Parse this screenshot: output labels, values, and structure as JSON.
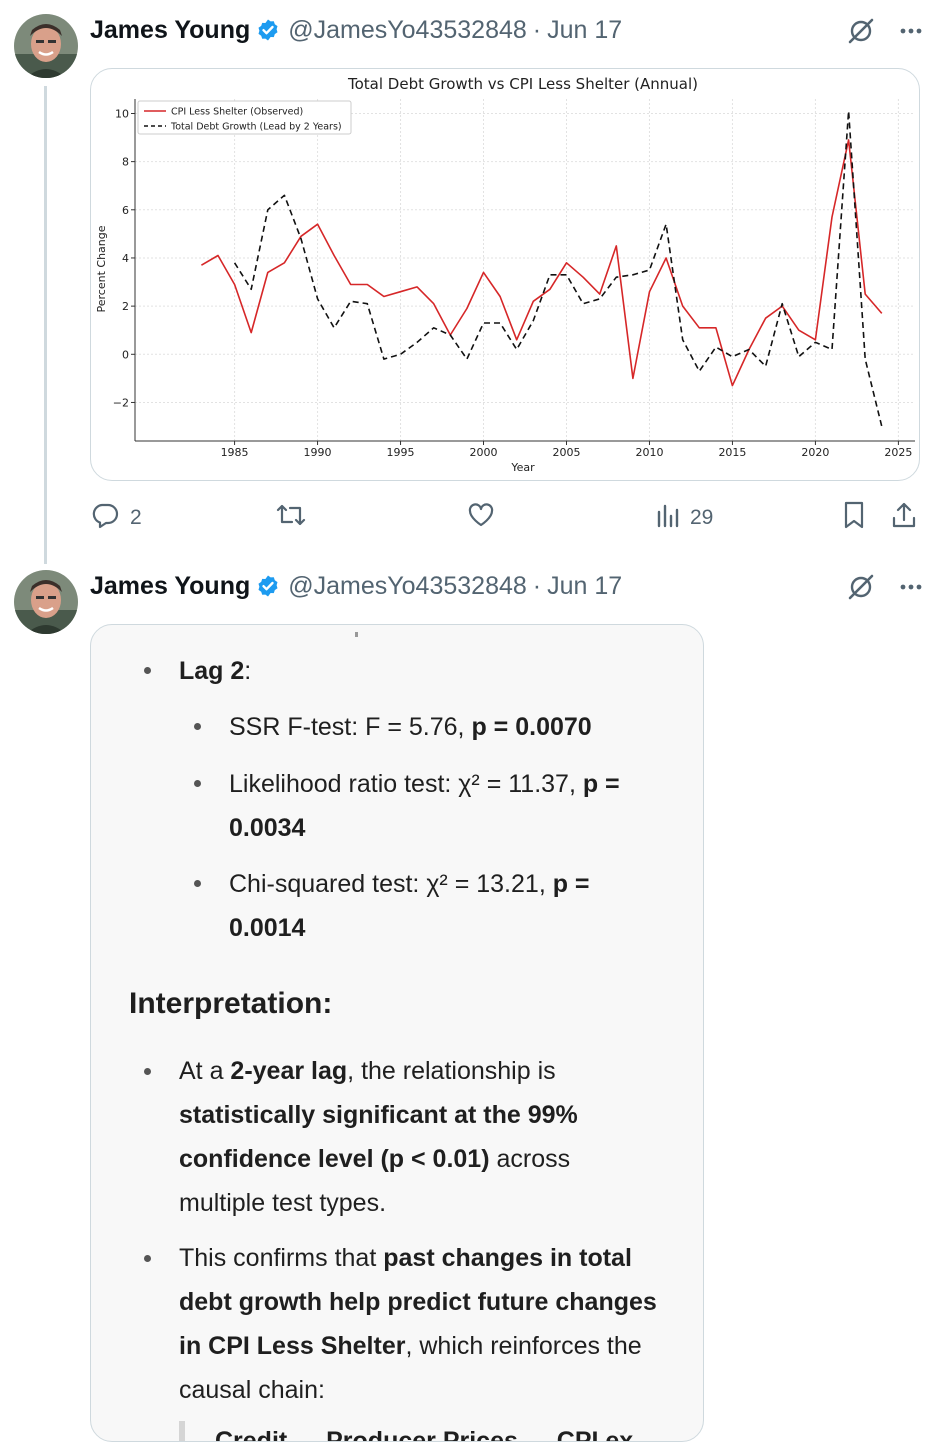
{
  "tweets": [
    {
      "author_name": "James Young",
      "handle": "@JamesYo43532848",
      "separator": "·",
      "date": "Jun 17",
      "actions": {
        "replies": "2",
        "retweets": "",
        "likes": "",
        "views": "29"
      }
    },
    {
      "author_name": "James Young",
      "handle": "@JamesYo43532848",
      "separator": "·",
      "date": "Jun 17"
    }
  ],
  "chart_data": {
    "type": "line",
    "title": "Total Debt Growth vs CPI Less Shelter (Annual)",
    "xlabel": "Year",
    "ylabel": "Percent Change",
    "xlim": [
      1979,
      2026
    ],
    "ylim": [
      -3.6,
      10.6
    ],
    "x_ticks": [
      "1985",
      "1990",
      "1995",
      "2000",
      "2005",
      "2010",
      "2015",
      "2020",
      "2025"
    ],
    "y_ticks": [
      "−2",
      "0",
      "2",
      "4",
      "6",
      "8",
      "10"
    ],
    "grid": true,
    "legend_position": "top-left",
    "series": [
      {
        "name": "CPI Less Shelter (Observed)",
        "color": "#d62728",
        "style": "solid",
        "x": [
          1983,
          1984,
          1985,
          1986,
          1987,
          1988,
          1989,
          1990,
          1991,
          1992,
          1993,
          1994,
          1995,
          1996,
          1997,
          1998,
          1999,
          2000,
          2001,
          2002,
          2003,
          2004,
          2005,
          2006,
          2007,
          2008,
          2009,
          2010,
          2011,
          2012,
          2013,
          2014,
          2015,
          2016,
          2017,
          2018,
          2019,
          2020,
          2021,
          2022,
          2023,
          2024
        ],
        "y": [
          3.7,
          4.1,
          2.9,
          0.9,
          3.4,
          3.8,
          4.9,
          5.4,
          4.1,
          2.9,
          2.9,
          2.4,
          2.6,
          2.8,
          2.1,
          0.8,
          1.9,
          3.4,
          2.4,
          0.6,
          2.2,
          2.7,
          3.8,
          3.2,
          2.5,
          4.5,
          -1.0,
          2.6,
          4.0,
          2.0,
          1.1,
          1.1,
          -1.3,
          0.2,
          1.5,
          2.0,
          1.0,
          0.6,
          5.7,
          8.9,
          2.5,
          1.7
        ]
      },
      {
        "name": "Total Debt Growth (Lead by 2 Years)",
        "color": "#111111",
        "style": "dashed",
        "x": [
          1985,
          1986,
          1987,
          1988,
          1989,
          1990,
          1991,
          1992,
          1993,
          1994,
          1995,
          1996,
          1997,
          1998,
          1999,
          2000,
          2001,
          2002,
          2003,
          2004,
          2005,
          2006,
          2007,
          2008,
          2009,
          2010,
          2011,
          2012,
          2013,
          2014,
          2015,
          2016,
          2017,
          2018,
          2019,
          2020,
          2021,
          2022,
          2023,
          2024
        ],
        "y": [
          3.8,
          2.7,
          6.0,
          6.6,
          4.8,
          2.3,
          1.1,
          2.2,
          2.1,
          -0.2,
          0.0,
          0.5,
          1.1,
          0.8,
          -0.2,
          1.3,
          1.3,
          0.2,
          1.4,
          3.3,
          3.3,
          2.1,
          2.3,
          3.2,
          3.3,
          3.5,
          5.4,
          0.6,
          -0.7,
          0.3,
          -0.1,
          0.2,
          -0.5,
          2.1,
          -0.1,
          0.5,
          0.2,
          10.1,
          -0.2,
          -3.0
        ]
      }
    ]
  },
  "screenshot": {
    "lag_label": "Lag 2",
    "lag_colon": ":",
    "sub_items": [
      {
        "text": "SSR F-test: F = 5.76, ",
        "bold": "p = 0.0070"
      },
      {
        "text": "Likelihood ratio test: χ² = 11.37, ",
        "bold": "p =",
        "bold2": "0.0034"
      },
      {
        "text": "Chi-squared test: χ² = 13.21, ",
        "bold": "p =",
        "bold2": "0.0014"
      }
    ],
    "heading": "Interpretation:",
    "interp1": {
      "pre": "At a ",
      "b1": "2-year lag",
      "mid": ", the relationship is",
      "b2": "statistically significant at the 99%",
      "b3": "confidence level (p < 0.01)",
      "post": " across",
      "line4": "multiple test types."
    },
    "interp2": {
      "pre": "This confirms that ",
      "b1": "past changes in total",
      "b2": "debt growth help predict future changes",
      "b3": "in CPI Less Shelter",
      "post": ", which reinforces the",
      "line4": "causal chain:"
    },
    "cut_text": "Credit → Producer Prices → CPI ex"
  }
}
